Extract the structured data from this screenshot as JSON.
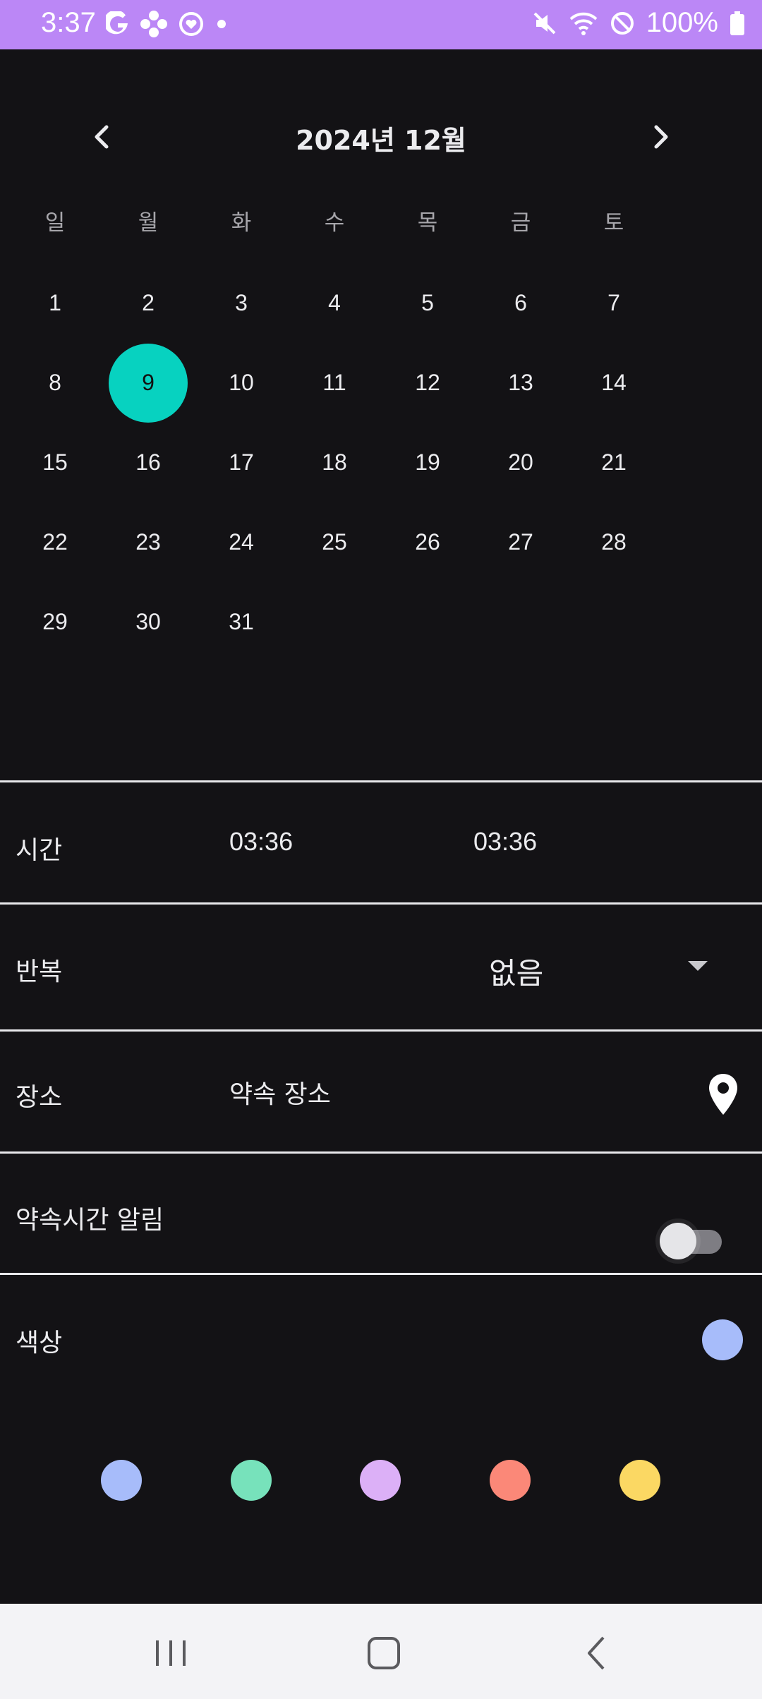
{
  "status_bar": {
    "time": "3:37",
    "battery": "100%",
    "left_icons": [
      "google-icon",
      "flower-icon",
      "heart-circle-icon",
      "dot-icon"
    ],
    "right_icons": [
      "mute-icon",
      "wifi-icon",
      "dnd-icon",
      "battery-icon"
    ]
  },
  "calendar": {
    "title": "2024년 12월",
    "weekdays": [
      "일",
      "월",
      "화",
      "수",
      "목",
      "금",
      "토"
    ],
    "days": [
      "1",
      "2",
      "3",
      "4",
      "5",
      "6",
      "7",
      "8",
      "9",
      "10",
      "11",
      "12",
      "13",
      "14",
      "15",
      "16",
      "17",
      "18",
      "19",
      "20",
      "21",
      "22",
      "23",
      "24",
      "25",
      "26",
      "27",
      "28",
      "29",
      "30",
      "31"
    ],
    "selected_day": "9",
    "selected_color": "#07d2c0"
  },
  "time_row": {
    "label": "시간",
    "start": "03:36",
    "end": "03:36"
  },
  "repeat_row": {
    "label": "반복",
    "value": "없음"
  },
  "place_row": {
    "label": "장소",
    "placeholder": "약속 장소"
  },
  "alarm_row": {
    "label": "약속시간 알림",
    "enabled": false
  },
  "color_row": {
    "label": "색상",
    "selected": "#a7bcfa"
  },
  "palette": [
    "#a7bcfa",
    "#77e2bb",
    "#dcb0f7",
    "#fb8878",
    "#fbd863"
  ]
}
